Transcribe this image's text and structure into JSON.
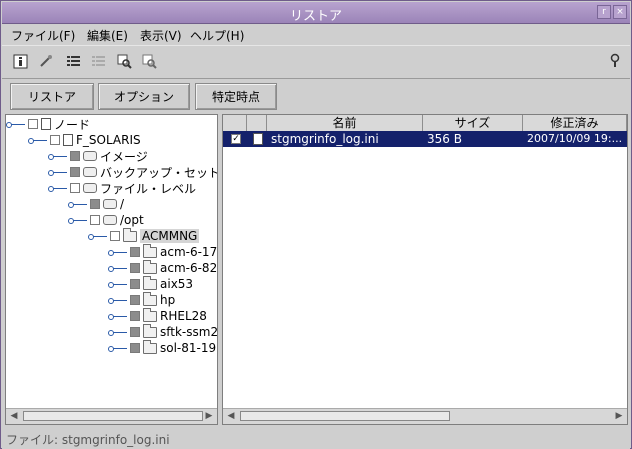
{
  "window": {
    "title": "リストア"
  },
  "menu": [
    {
      "label": "ファイル(F)"
    },
    {
      "label": "編集(E)"
    },
    {
      "label": "表示(V)"
    },
    {
      "label": "ヘルプ(H)"
    }
  ],
  "buttons": {
    "restore": "リストア",
    "options": "オプション",
    "point_in_time": "特定時点"
  },
  "tree": {
    "root": "ノード",
    "node": "F_SOLARIS",
    "image": "イメージ",
    "backup_set": "バックアップ・セット",
    "file_level": "ファイル・レベル",
    "root_dir": "/",
    "opt_dir": "/opt",
    "selected_dir": "ACMMNG",
    "children": [
      {
        "label": "acm-6-17"
      },
      {
        "label": "acm-6-82"
      },
      {
        "label": "aix53"
      },
      {
        "label": "hp"
      },
      {
        "label": "RHEL28"
      },
      {
        "label": "sftk-ssm2"
      },
      {
        "label": "sol-81-19"
      }
    ]
  },
  "table": {
    "headers": {
      "name": "名前",
      "size": "サイズ",
      "modified": "修正済み"
    },
    "rows": [
      {
        "name": "stgmgrinfo_log.ini",
        "size": "356 B",
        "modified": "2007/10/09 19:..."
      }
    ]
  },
  "status": {
    "text": "ファイル: stgmgrinfo_log.ini"
  },
  "colors": {
    "titlebar": "#9b84b8",
    "selection": "#14216b",
    "connector": "#2a5aa8"
  }
}
